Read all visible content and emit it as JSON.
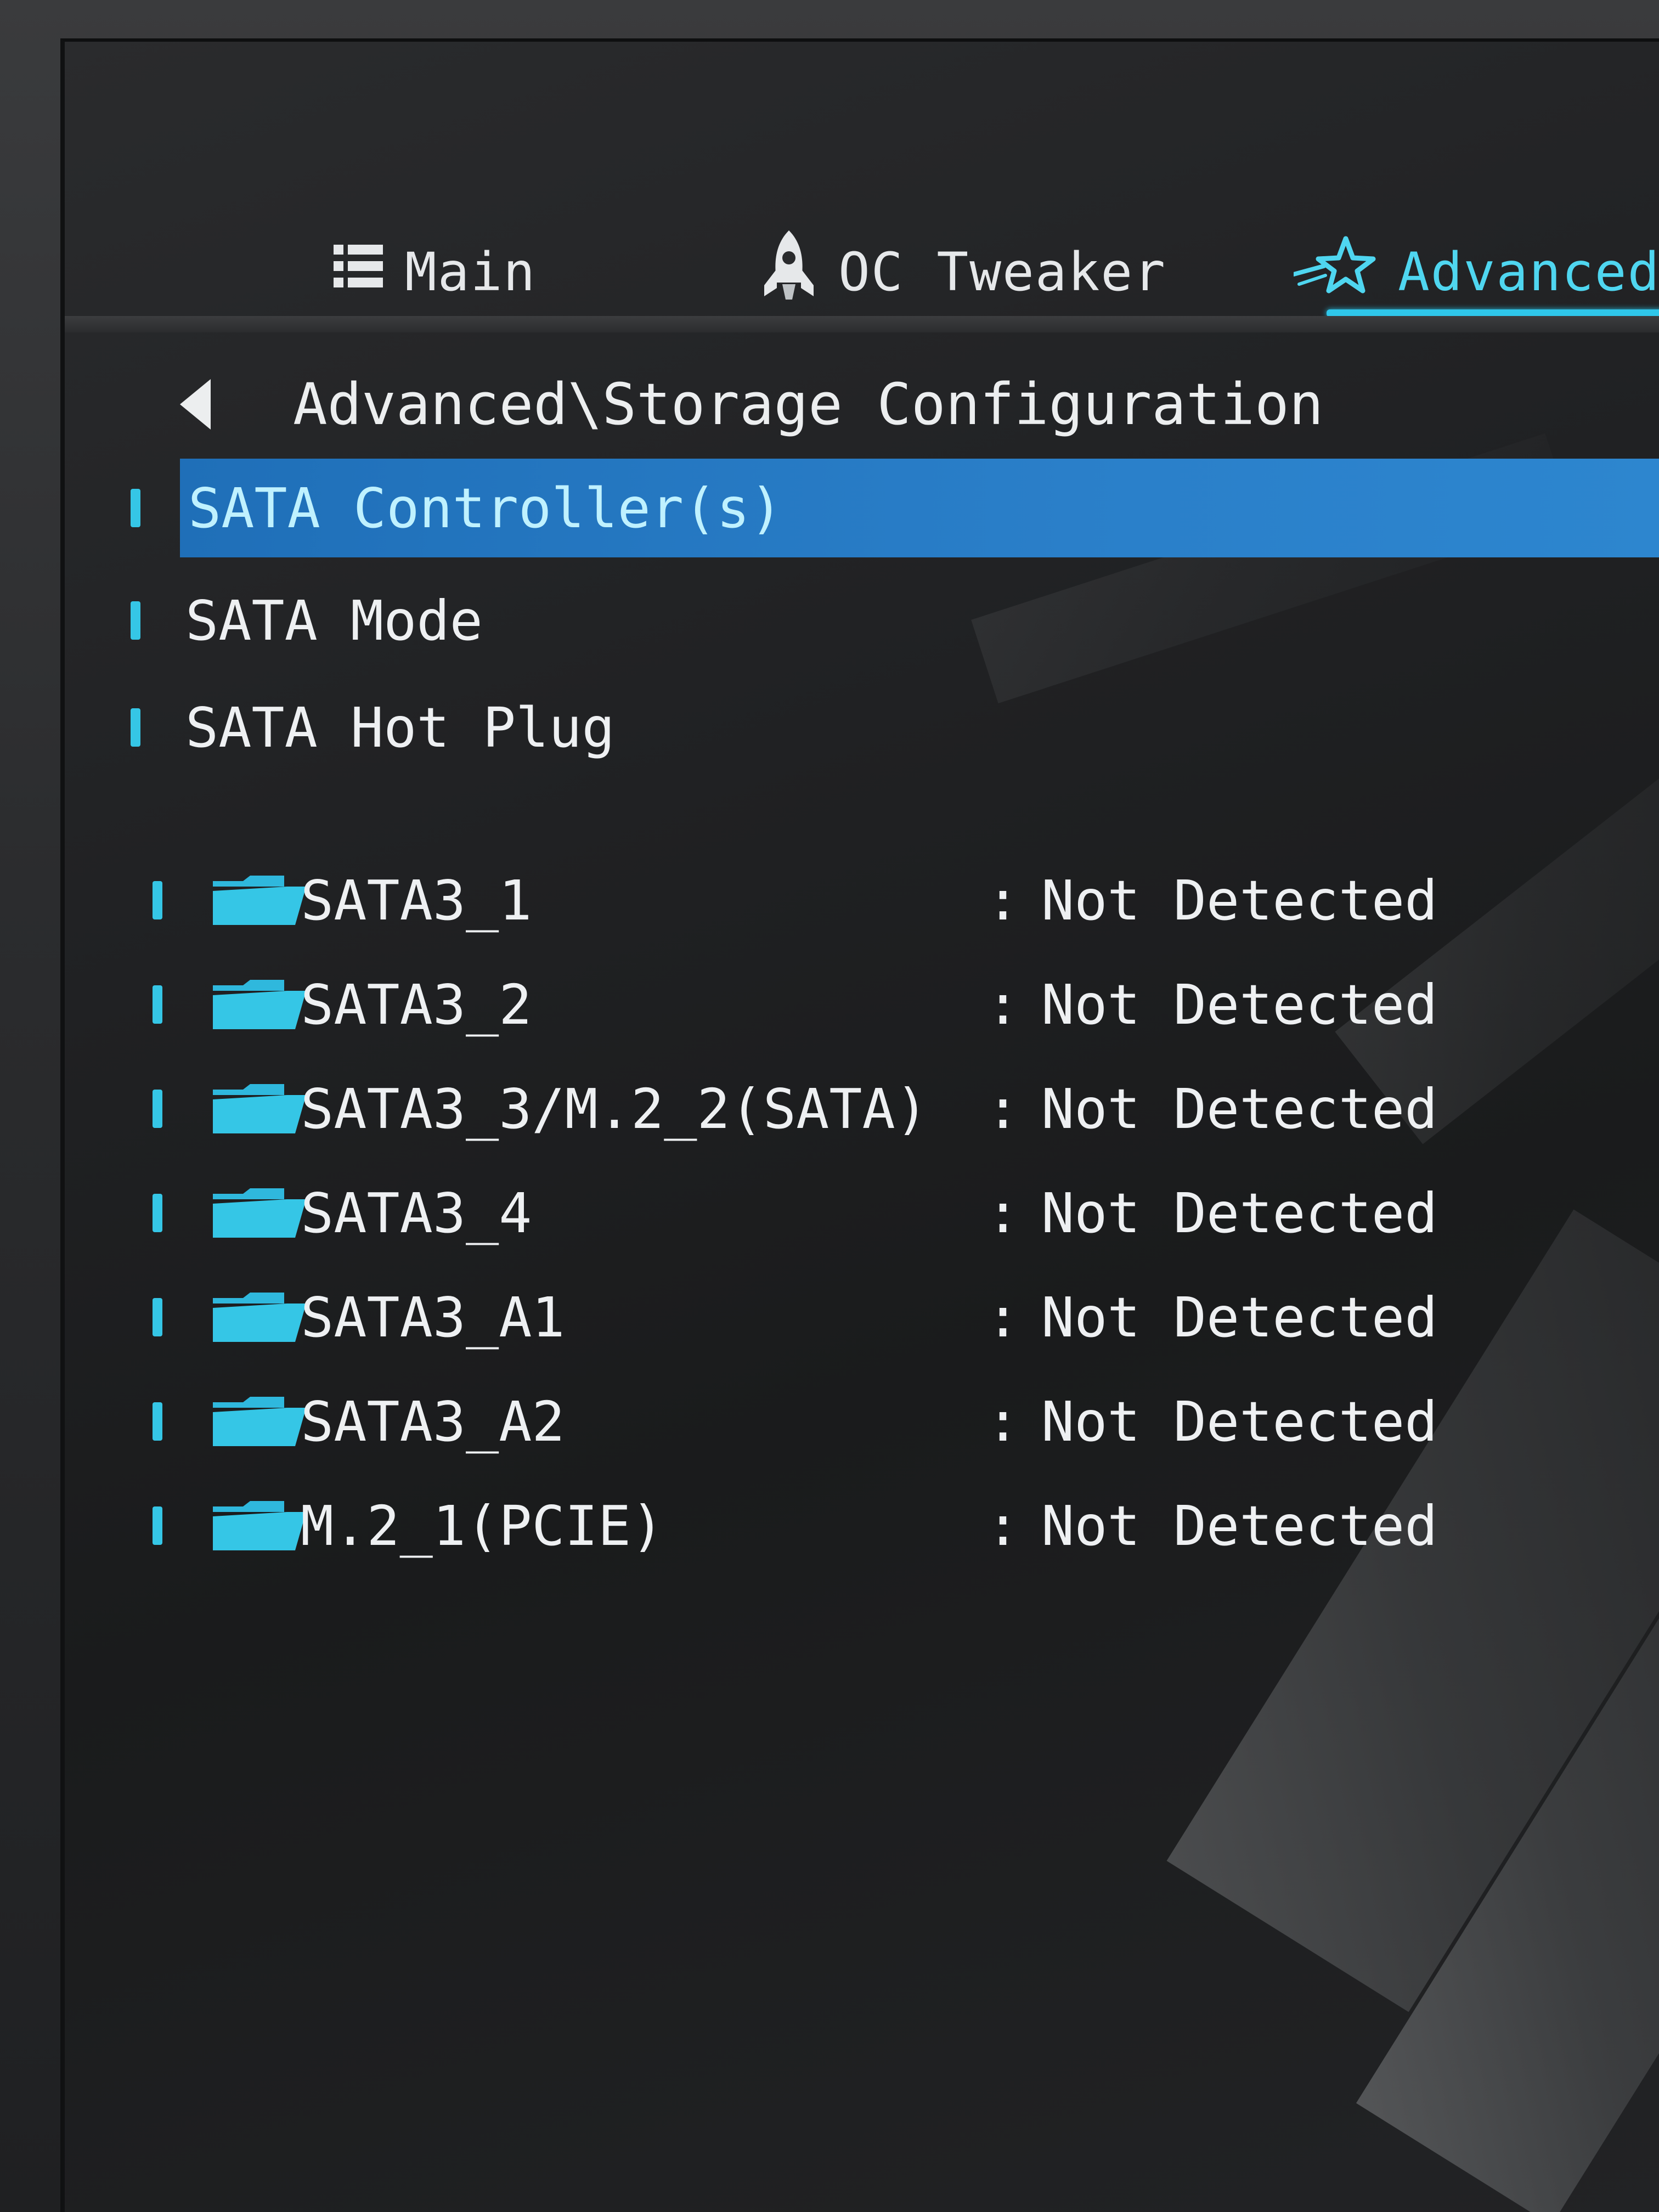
{
  "tabs": [
    {
      "label": "Main",
      "icon": "list-icon",
      "active": false
    },
    {
      "label": "OC Tweaker",
      "icon": "rocket-icon",
      "active": false
    },
    {
      "label": "Advanced",
      "icon": "star-icon",
      "active": true
    }
  ],
  "breadcrumb": "Advanced\\Storage Configuration",
  "settings": [
    {
      "label": "SATA Controller(s)",
      "selected": true
    },
    {
      "label": "SATA Mode",
      "selected": false
    },
    {
      "label": "SATA Hot Plug",
      "selected": false
    }
  ],
  "devices": [
    {
      "name": "SATA3_1",
      "value": "Not Detected"
    },
    {
      "name": "SATA3_2",
      "value": "Not Detected"
    },
    {
      "name": "SATA3_3/M.2_2(SATA)",
      "value": "Not Detected"
    },
    {
      "name": "SATA3_4",
      "value": "Not Detected"
    },
    {
      "name": "SATA3_A1",
      "value": "Not Detected"
    },
    {
      "name": "SATA3_A2",
      "value": "Not Detected"
    },
    {
      "name": "M.2_1(PCIE)",
      "value": "Not Detected"
    }
  ],
  "separator": ":",
  "colors": {
    "accent": "#35c6e6",
    "selection": "#2a7fc9",
    "text": "#eef0f2",
    "background": "#1f2022"
  }
}
